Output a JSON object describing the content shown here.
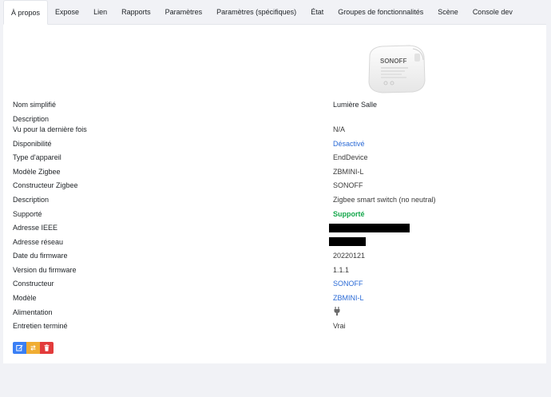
{
  "tabs": [
    {
      "label": "À propos",
      "active": true
    },
    {
      "label": "Expose"
    },
    {
      "label": "Lien"
    },
    {
      "label": "Rapports"
    },
    {
      "label": "Paramètres"
    },
    {
      "label": "Paramètres (spécifiques)"
    },
    {
      "label": "État"
    },
    {
      "label": "Groupes de fonctionnalités"
    },
    {
      "label": "Scène"
    },
    {
      "label": "Console dev"
    }
  ],
  "device_image": {
    "brand_text": "SONOFF",
    "icon": "sonoff-zbmini-device-image"
  },
  "rows": [
    {
      "label": "Nom simplifié",
      "value": "Lumière Salle"
    },
    {
      "label": "Description",
      "value": ""
    },
    {
      "label": "Vu pour la dernière fois",
      "value": "N/A"
    },
    {
      "label": "Disponibilité",
      "value": "Désactivé"
    },
    {
      "label": "Type d'appareil",
      "value": "EndDevice"
    },
    {
      "label": "Modèle Zigbee",
      "value": "ZBMINI-L"
    },
    {
      "label": "Constructeur Zigbee",
      "value": "SONOFF"
    },
    {
      "label": "Description",
      "value": "Zigbee smart switch (no neutral)"
    },
    {
      "label": "Supporté",
      "value": "Supporté"
    },
    {
      "label": "Adresse IEEE",
      "value": ""
    },
    {
      "label": "Adresse réseau",
      "value": ""
    },
    {
      "label": "Date du firmware",
      "value": "20220121"
    },
    {
      "label": "Version du firmware",
      "value": "1.1.1"
    },
    {
      "label": "Constructeur",
      "value": "SONOFF"
    },
    {
      "label": "Modèle",
      "value": "ZBMINI-L"
    },
    {
      "label": "Alimentation",
      "value": "",
      "icon": "power-plug-icon"
    },
    {
      "label": "Entretien terminé",
      "value": "Vrai"
    }
  ],
  "actions": [
    {
      "icon": "edit-icon",
      "color": "#3a7ff5"
    },
    {
      "icon": "rename-icon",
      "color": "#f0ad33"
    },
    {
      "icon": "trash-icon",
      "color": "#e23b3b"
    }
  ]
}
